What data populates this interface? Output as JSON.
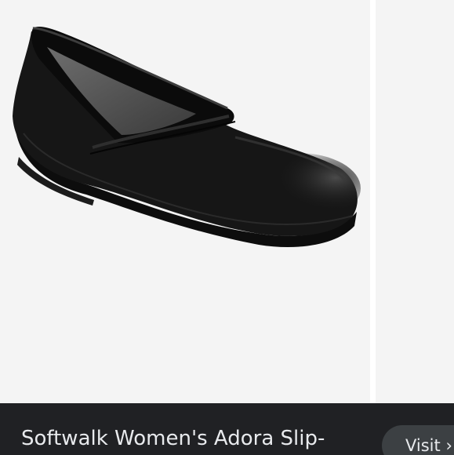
{
  "product": {
    "title": "Softwalk Women's Adora Slip-"
  },
  "actions": {
    "visit_label": "Visit",
    "visit_arrow": "›"
  },
  "colors": {
    "image_background": "#f4f4f4",
    "bottom_bar": "#202124",
    "title_text": "#e8eaed",
    "button_background": "#3c4043"
  },
  "image": {
    "subject": "black leather slip-on clog shoe"
  }
}
